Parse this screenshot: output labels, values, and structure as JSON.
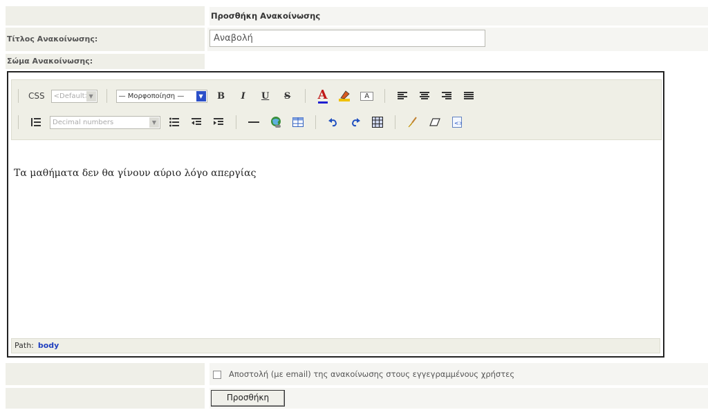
{
  "form": {
    "header_title": "Προσθήκη Ανακοίνωσης",
    "title_label": "Τίτλος Ανακοίνωσης:",
    "title_value": "Αναβολή",
    "body_label": "Σώμα Ανακοίνωσης:",
    "email_label": "Αποστολή (με email) της ανακοίνωσης στους εγγεγραμμένους χρήστες",
    "email_checked": false,
    "submit_label": "Προσθήκη"
  },
  "editor": {
    "css_label": "CSS",
    "css_select_value": "<Default>",
    "format_select_value": "— Μορφοποίηση —",
    "list_style_value": "Decimal numbers",
    "buttons": {
      "bold": "B",
      "italic": "I",
      "underline": "U",
      "strike": "S",
      "font_color": "A",
      "bg_color": "A"
    },
    "content": "Τα μαθήματα δεν θα γίνουν αύριο λόγο απεργίας",
    "path_label": "Path:",
    "path_value": "body"
  },
  "colors": {
    "accent": "#2040c0",
    "font_color_icon": "#c01818",
    "label_bg": "#efefe8",
    "toolbar_bg": "#efefe6"
  },
  "icons": [
    "numbered-list-icon",
    "bullet-list-icon",
    "outdent-icon",
    "indent-icon",
    "horizontal-rule-icon",
    "link-icon",
    "table-icon",
    "undo-icon",
    "redo-icon",
    "grid-icon",
    "brush-icon",
    "eraser-icon",
    "source-icon",
    "align-left-icon",
    "align-center-icon",
    "align-right-icon",
    "justify-icon"
  ]
}
